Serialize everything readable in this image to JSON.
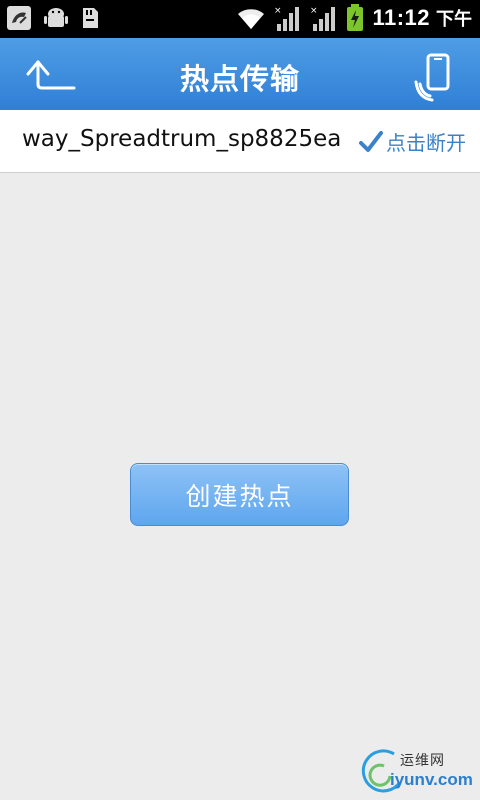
{
  "status_bar": {
    "time": "11:12",
    "ampm": "下午",
    "icons_left": [
      "missed-call-icon",
      "android-debug-icon",
      "sd-card-icon"
    ],
    "icons_right": [
      "wifi-icon",
      "signal-icon",
      "signal-icon",
      "battery-charging-icon"
    ]
  },
  "header": {
    "title": "热点传输",
    "back_icon": "back-arrow-icon",
    "device_icon": "phone-connect-icon"
  },
  "connection": {
    "ssid": "way_Spreadtrum_sp8825ea",
    "disconnect_label": "点击断开",
    "check_icon": "checkmark-icon"
  },
  "main": {
    "create_button_label": "创建热点"
  },
  "watermark": {
    "top_text": "运维网",
    "bottom_text": "iyunv.com"
  },
  "colors": {
    "header_blue": "#2f7fd6",
    "accent_blue": "#3b82c8",
    "button_blue": "#6aaef0",
    "background": "#ececec",
    "battery_green": "#7cc62c"
  }
}
